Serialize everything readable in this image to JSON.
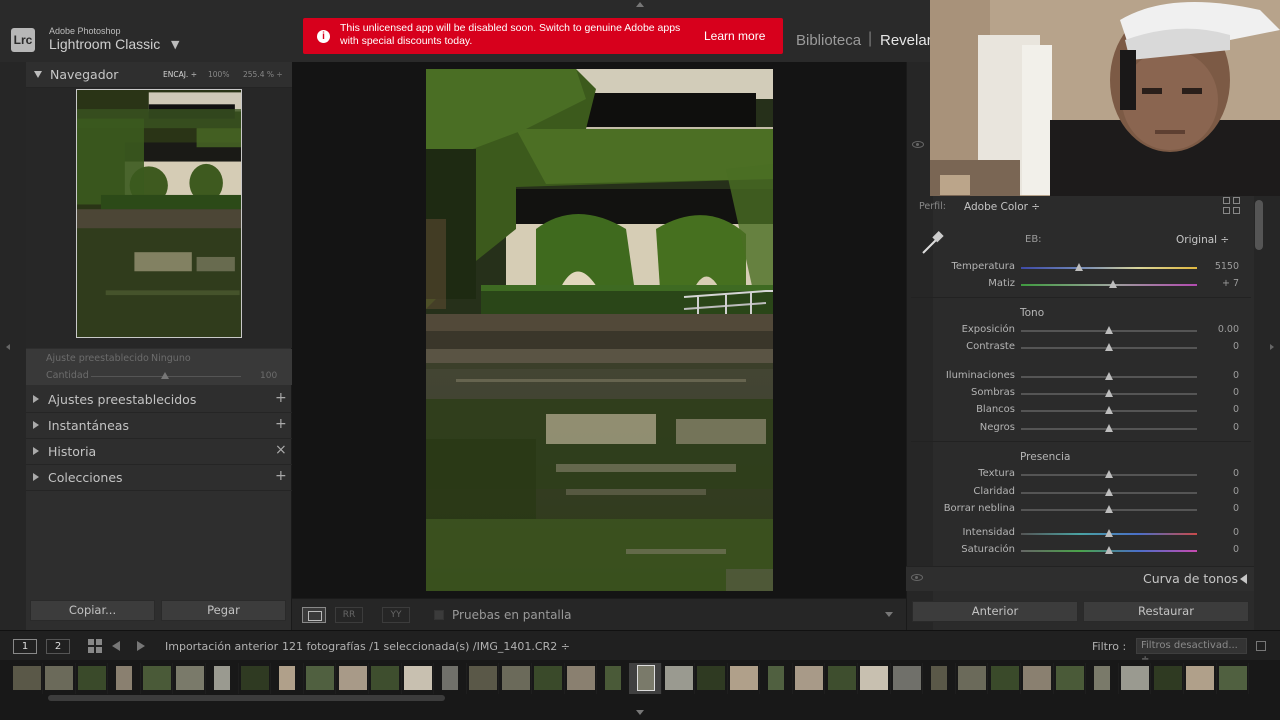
{
  "app": {
    "maker": "Adobe Photoshop",
    "name": "Lightroom Classic",
    "logo": "Lrc",
    "menu_arrow": "▼"
  },
  "banner": {
    "message": "This unlicensed app will be disabled soon. Switch to genuine Adobe apps with special discounts today.",
    "link": "Learn more",
    "icon": "info-icon"
  },
  "modules": {
    "library": "Biblioteca",
    "develop": "Revelar",
    "separator": "|"
  },
  "navigator": {
    "title": "Navegador",
    "zoom_fit": "ENCAJ. ÷",
    "zoom_100": "100% ",
    "zoom_custom": "255.4 % ÷"
  },
  "preset_adjust": {
    "label": "Ajuste preestablecido",
    "value": "Ninguno",
    "amount_label": "Cantidad",
    "amount_value": "100",
    "amount_level": 0.47
  },
  "left_sections": [
    {
      "label": "Ajustes preestablecidos",
      "action": "+"
    },
    {
      "label": "Instantáneas",
      "action": "+"
    },
    {
      "label": "Historia",
      "action": "×"
    },
    {
      "label": "Colecciones",
      "action": "+"
    }
  ],
  "left_buttons": {
    "copy": "Copiar...",
    "paste": "Pegar"
  },
  "toolbar": {
    "soft_proof": "Pruebas en pantalla"
  },
  "profile": {
    "label": "Perfil:",
    "value": "Adobe Color ÷"
  },
  "white_balance": {
    "label": "EB:",
    "value": "Original ÷"
  },
  "groups": {
    "tone": "Tono",
    "presence": "Presencia"
  },
  "sliders": {
    "temperatura": {
      "label": "Temperatura",
      "value": "5150",
      "level": 0.33
    },
    "matiz": {
      "label": "Matiz",
      "value": "+ 7",
      "level": 0.52
    },
    "exposicion": {
      "label": "Exposición",
      "value": "0.00",
      "level": 0.5
    },
    "contraste": {
      "label": "Contraste",
      "value": "0",
      "level": 0.5
    },
    "iluminaciones": {
      "label": "Iluminaciones",
      "value": "0",
      "level": 0.5
    },
    "sombras": {
      "label": "Sombras",
      "value": "0",
      "level": 0.5
    },
    "blancos": {
      "label": "Blancos",
      "value": "0",
      "level": 0.5
    },
    "negros": {
      "label": "Negros",
      "value": "0",
      "level": 0.5
    },
    "textura": {
      "label": "Textura",
      "value": "0",
      "level": 0.5
    },
    "claridad": {
      "label": "Claridad",
      "value": "0",
      "level": 0.5
    },
    "borrar_neblina": {
      "label": "Borrar neblina",
      "value": "0",
      "level": 0.5
    },
    "intensidad": {
      "label": "Intensidad",
      "value": "0",
      "level": 0.5
    },
    "saturacion": {
      "label": "Saturación",
      "value": "0",
      "level": 0.5
    }
  },
  "tone_curve": {
    "label": "Curva de tonos"
  },
  "right_buttons": {
    "previous": "Anterior",
    "reset": "Restaurar"
  },
  "filmbar": {
    "screen1": "1",
    "screen2": "2",
    "source": "Importación anterior",
    "count": "121 fotografías /1 seleccionada(s) /IMG_1401.CR2 ÷",
    "filter_label": "Filtro :",
    "filter_value": "Filtros desactivad... ÷"
  }
}
